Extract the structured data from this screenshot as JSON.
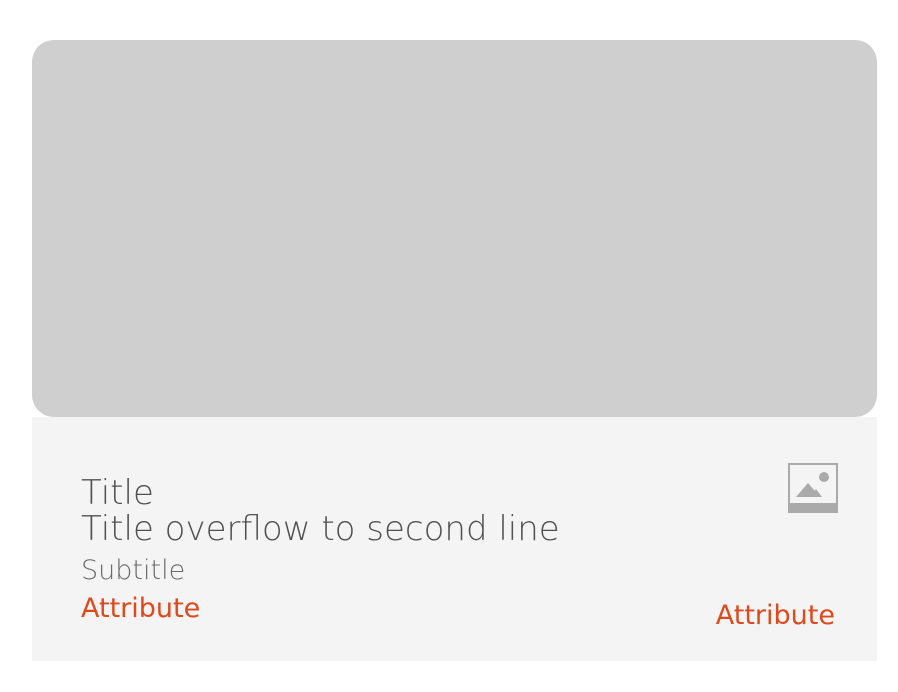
{
  "card": {
    "title_line_1": "Title",
    "title_line_2": "Title overflow to second line",
    "subtitle": "Subtitle",
    "attribute_left": "Attribute",
    "attribute_right": "Attribute",
    "icon": "image-icon"
  },
  "colors": {
    "image_placeholder": "#cfcfcf",
    "body_background": "#f4f4f4",
    "title_text": "#505050",
    "subtitle_text": "#6a6a6a",
    "attribute_text": "#dc4a1d",
    "icon": "#aaaaaa"
  }
}
